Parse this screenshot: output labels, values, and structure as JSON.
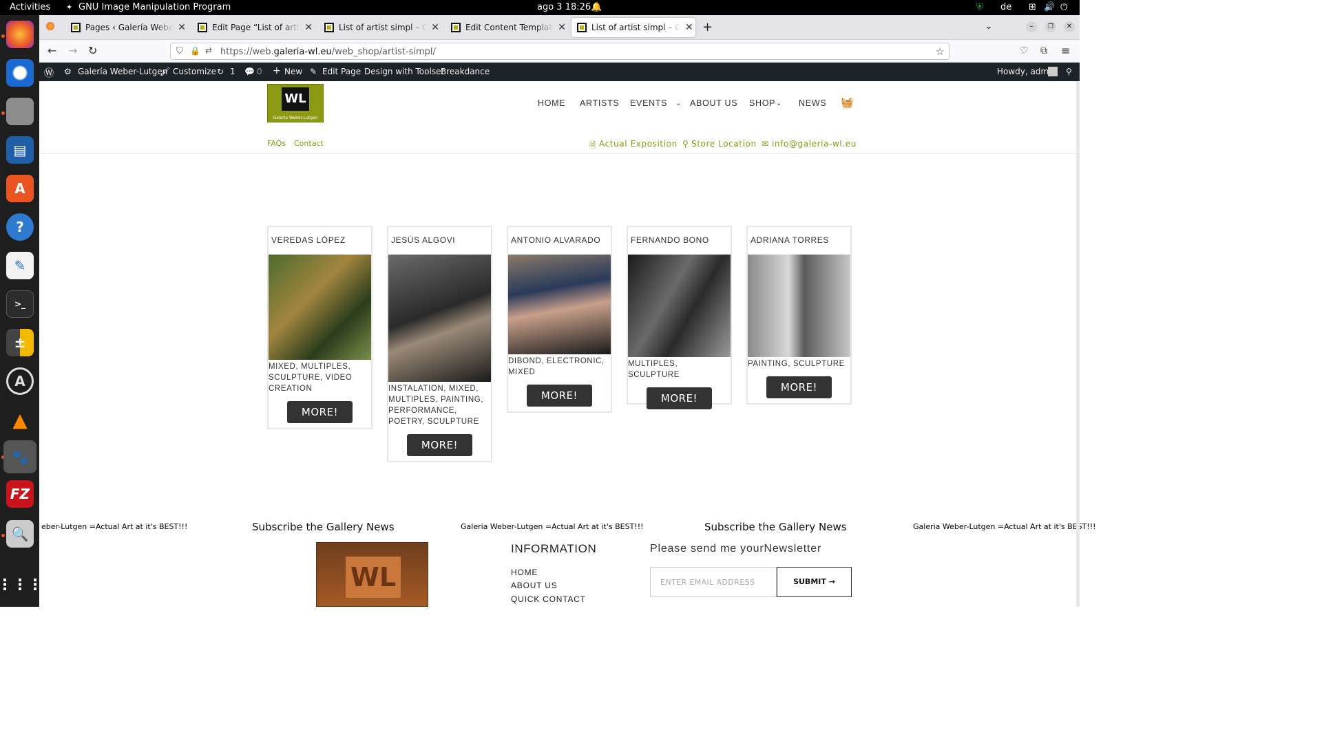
{
  "system": {
    "activities": "Activities",
    "app": "GNU Image Manipulation Program",
    "datetime": "ago 3  18:26",
    "lang": "de"
  },
  "browser": {
    "tabs": [
      {
        "title": "Pages ‹ Galería Weber-Lutgen"
      },
      {
        "title": "Edit Page “List of artist simpl”"
      },
      {
        "title": "List of artist simpl – Galería"
      },
      {
        "title": "Edit Content Template “T"
      },
      {
        "title": "List of artist simpl – Galería"
      }
    ],
    "url_prefix": "https://web.",
    "url_domain": "galeria-wl.eu",
    "url_path": "/web_shop/artist-simpl/"
  },
  "wpbar": {
    "site": "Galería Weber-Lutgen",
    "customize": "Customize",
    "updates": "1",
    "comments": "0",
    "new": "New",
    "edit": "Edit Page",
    "toolset": "Design with Toolset",
    "breakdance": "Breakdance",
    "greeting": "Howdy, admin"
  },
  "site": {
    "logo": {
      "mark": "WL",
      "caption": "Galeria Weber-Lutgen"
    },
    "menu": [
      "HOME",
      "ARTISTS",
      "EVENTS",
      "ABOUT US",
      "SHOP",
      "NEWS"
    ],
    "sub_left": [
      "FAQs",
      "Contact"
    ],
    "sub_right": [
      "Actual Exposition",
      "Store Location",
      "info@galeria-wl.eu"
    ]
  },
  "artists": [
    {
      "name": "VEREDAS LÓPEZ",
      "cats": "MIXED, MULTIPLES, SCULPTURE, VIDEO CREATION",
      "btn": "MORE!"
    },
    {
      "name": "JESÚS ALGOVI",
      "cats": "INSTALATION, MIXED, MULTIPLES, PAINTING, PERFORMANCE, POETRY, SCULPTURE",
      "btn": "MORE!"
    },
    {
      "name": "ANTONIO ALVARADO",
      "cats": "DIBOND, ELECTRONIC, MIXED",
      "btn": "MORE!"
    },
    {
      "name": "FERNANDO BONO",
      "cats": "MULTIPLES, SCULPTURE",
      "btn": "MORE!"
    },
    {
      "name": "ADRIANA TORRES",
      "cats": "PAINTING, SCULPTURE",
      "btn": "MORE!"
    }
  ],
  "footer": {
    "marquee_start": "eber-Lutgen  =Actual Art at it's BEST!!!",
    "marquee_mid": "Galeria Weber-Lutgen  =Actual Art at it's BEST!!!",
    "marquee_end": "Galeria Weber-Lutgen  =Actual Art at it's BEST!!!",
    "subscribe": "Subscribe the Gallery News",
    "info_title": "INFORMATION",
    "links": [
      "HOME",
      "ABOUT US",
      "QUICK CONTACT"
    ],
    "newsletter": "Please send me yourNewsletter",
    "email_placeholder": "ENTER EMAIL ADDRESS",
    "submit": "SUBMIT →"
  },
  "colors": {
    "accent": "#8b9a12",
    "wpbar": "#1d2327",
    "button": "#333333"
  }
}
